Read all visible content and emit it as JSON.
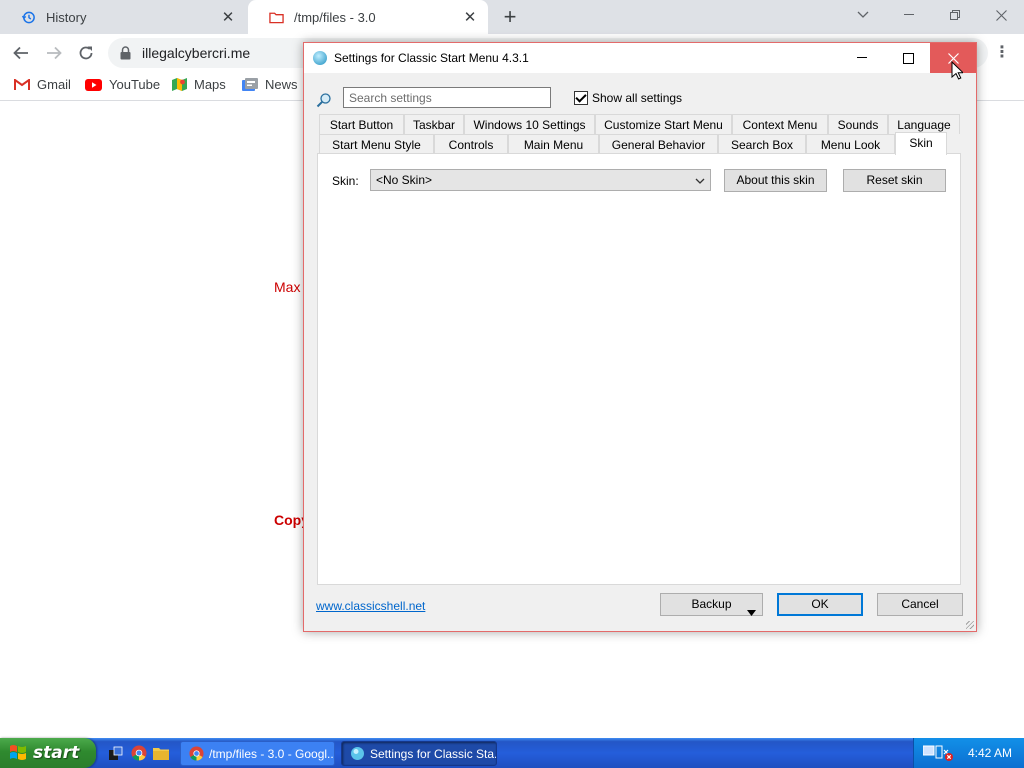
{
  "browser": {
    "tabs": [
      {
        "title": "History",
        "active": false
      },
      {
        "title": "/tmp/files - 3.0",
        "active": true
      }
    ],
    "url": "illegalcybercri.me",
    "bookmarks": [
      "Gmail",
      "YouTube",
      "Maps",
      "News"
    ],
    "page_fragments": [
      "Max",
      "Copy"
    ]
  },
  "dialog": {
    "title": "Settings for Classic Start Menu 4.3.1",
    "search_placeholder": "Search settings",
    "show_all_label": "Show all settings",
    "show_all_checked": true,
    "tabs_row1": [
      "Start Button",
      "Taskbar",
      "Windows 10 Settings",
      "Customize Start Menu",
      "Context Menu",
      "Sounds",
      "Language"
    ],
    "tabs_row2": [
      "Start Menu Style",
      "Controls",
      "Main Menu",
      "General Behavior",
      "Search Box",
      "Menu Look",
      "Skin"
    ],
    "selected_tab": "Skin",
    "skin_label": "Skin:",
    "skin_value": "<No Skin>",
    "about_skin": "About this skin",
    "reset_skin": "Reset skin",
    "link": "www.classicshell.net",
    "backup": "Backup",
    "ok": "OK",
    "cancel": "Cancel"
  },
  "taskbar": {
    "start": "start",
    "task_chrome": "/tmp/files - 3.0 - Googl...",
    "task_settings": "Settings for Classic Sta...",
    "time": "4:42 AM"
  },
  "colors": {
    "dialog_close": "#e35a5a",
    "taskbar_blue": "#245edb",
    "start_green": "#2f8a2f",
    "link_blue": "#0066cc"
  }
}
